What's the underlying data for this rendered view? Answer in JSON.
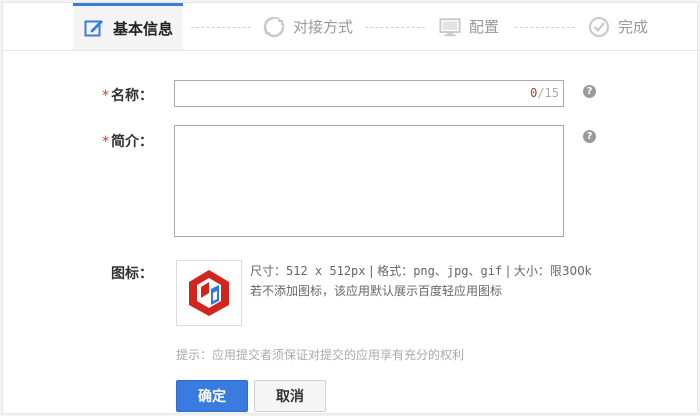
{
  "steps": [
    {
      "label": "基本信息",
      "icon": "edit-icon",
      "active": true
    },
    {
      "label": "对接方式",
      "icon": "refresh-icon",
      "active": false
    },
    {
      "label": "配置",
      "icon": "monitor-icon",
      "active": false
    },
    {
      "label": "完成",
      "icon": "check-circle-icon",
      "active": false
    }
  ],
  "form": {
    "required_mark": "*",
    "name": {
      "label": "名称：",
      "value": "",
      "count": "0",
      "max": "/15",
      "help": "?"
    },
    "intro": {
      "label": "简介：",
      "value": "",
      "help": "?"
    },
    "icon": {
      "label": "图标：",
      "spec_size_prefix": "尺寸：",
      "spec_size": "512 x 512px",
      "spec_format_prefix": " | 格式：",
      "spec_format": "png、jpg、gif",
      "spec_limit_prefix": " | 大小：",
      "spec_limit": "限300k",
      "note": "若不添加图标，该应用默认展示百度轻应用图标"
    },
    "hint": "提示：应用提交者须保证对提交的应用享有充分的权利"
  },
  "buttons": {
    "confirm": "确定",
    "cancel": "取消"
  },
  "colors": {
    "accent": "#3a7be0",
    "required": "#e0322b",
    "logo_red": "#d0261e",
    "logo_blue": "#2a7be4"
  }
}
